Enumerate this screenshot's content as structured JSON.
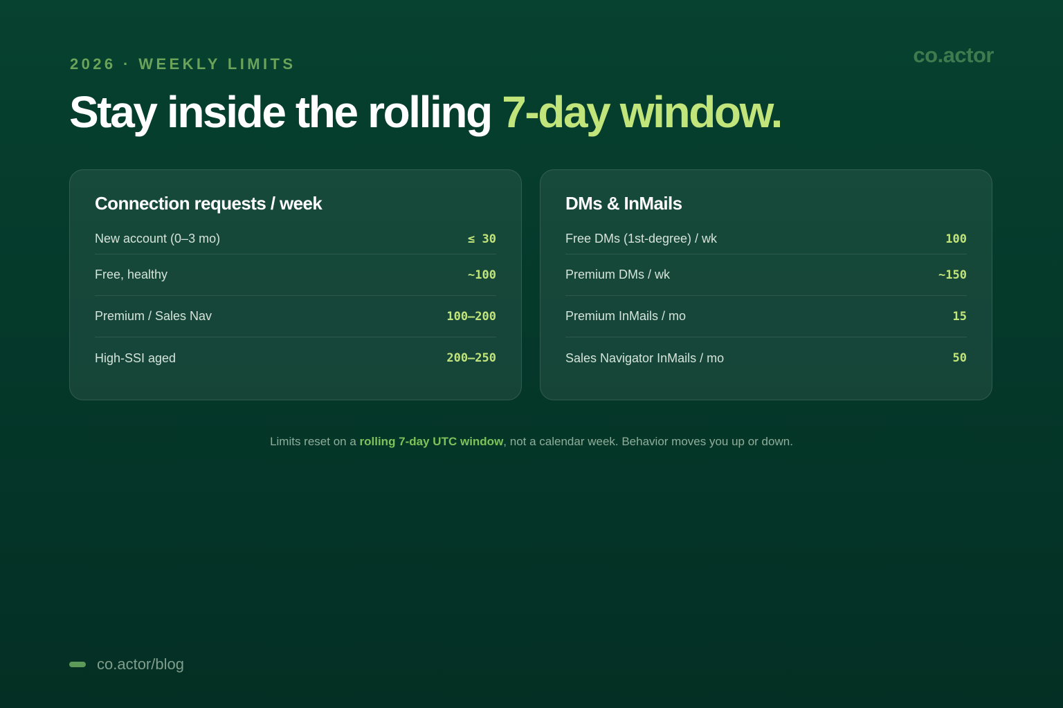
{
  "eyebrow": "2026 · WEEKLY LIMITS",
  "brand": "co.actor",
  "headline": {
    "main": "Stay inside the rolling ",
    "accent": "7-day window."
  },
  "cards": [
    {
      "title": "Connection requests / week",
      "rows": [
        {
          "label": "New account (0–3 mo)",
          "value": "≤ 30"
        },
        {
          "label": "Free, healthy",
          "value": "~100"
        },
        {
          "label": "Premium / Sales Nav",
          "value": "100–200"
        },
        {
          "label": "High-SSI aged",
          "value": "200–250"
        }
      ]
    },
    {
      "title": "DMs & InMails",
      "rows": [
        {
          "label": "Free DMs (1st-degree) / wk",
          "value": "100"
        },
        {
          "label": "Premium DMs / wk",
          "value": "~150"
        },
        {
          "label": "Premium InMails / mo",
          "value": "15"
        },
        {
          "label": "Sales Navigator InMails / mo",
          "value": "50"
        }
      ]
    }
  ],
  "footnote": {
    "before": "Limits reset on a ",
    "highlight": "rolling 7-day UTC window",
    "after": ", not a calendar week. Behavior moves you up or down."
  },
  "footer": {
    "link": "co.actor/blog"
  },
  "colors": {
    "accent": "#c2e57b",
    "background": "#053a2b",
    "highlight": "#7dc25a"
  }
}
